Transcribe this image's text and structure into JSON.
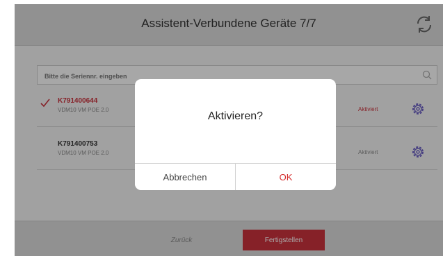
{
  "header": {
    "title": "Assistent-Verbundene Geräte 7/7",
    "refresh_icon": "refresh-icon"
  },
  "search": {
    "placeholder": "Bitte die Seriennr. eingeben",
    "icon": "search-icon"
  },
  "devices": [
    {
      "id": "K791400644",
      "model": "VDM10 VM POE 2.0",
      "status": "Aktiviert",
      "selected": true,
      "icon": "gear-icon"
    },
    {
      "id": "K791400753",
      "model": "VDM10 VM POE 2.0",
      "status": "Aktiviert",
      "selected": false,
      "icon": "gear-icon"
    }
  ],
  "footer": {
    "back_label": "Zurück",
    "finish_label": "Fertigstellen"
  },
  "dialog": {
    "title": "Aktivieren?",
    "cancel_label": "Abbrechen",
    "ok_label": "OK"
  },
  "colors": {
    "accent": "#c8323c",
    "header_bg": "#d8d8d8",
    "gear": "#6a5fc1"
  }
}
